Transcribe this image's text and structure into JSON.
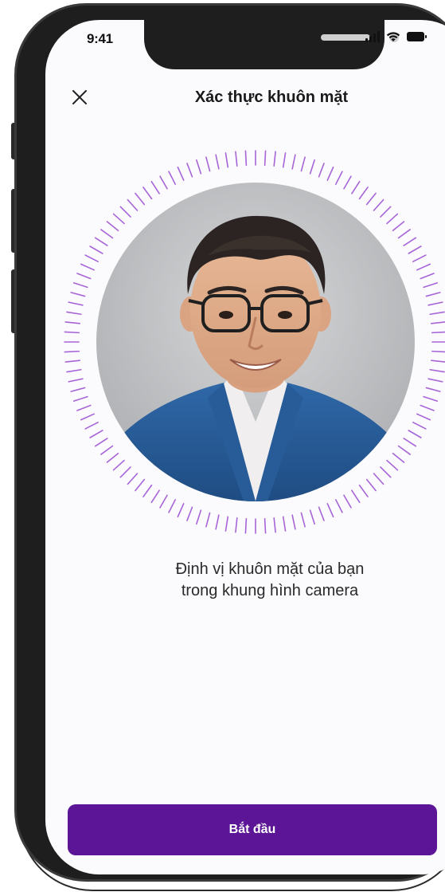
{
  "status_bar": {
    "time": "9:41",
    "icons": [
      "signal-icon",
      "wifi-icon",
      "battery-icon"
    ]
  },
  "header": {
    "close_icon": "close-icon",
    "title": "Xác thực khuôn mặt"
  },
  "camera": {
    "ring_color": "#a765d8",
    "photo_alt": "face preview"
  },
  "instruction": {
    "line1": "Định vị khuôn mặt của bạn",
    "line2": "trong khung hình camera"
  },
  "primary_action": {
    "label": "Bắt đầu",
    "color": "#5b1596"
  }
}
